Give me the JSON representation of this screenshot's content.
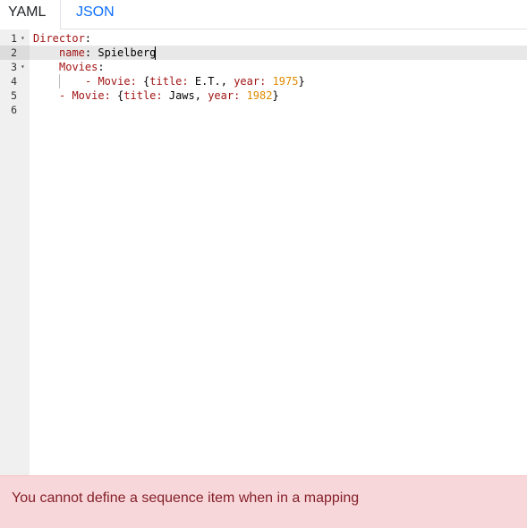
{
  "tabs": {
    "yaml": "YAML",
    "json": "JSON"
  },
  "editor": {
    "line_numbers": [
      "1",
      "2",
      "3",
      "4",
      "5",
      "6"
    ],
    "fold_marker": "▾",
    "lines": [
      {
        "key": "Director",
        "colon": ":"
      },
      {
        "key": "name",
        "colon": ":",
        "value": " Spielberg"
      },
      {
        "key": "Movies",
        "colon": ":"
      },
      {
        "dash": "- ",
        "key": "Movie",
        "colon": ":",
        "open": " {",
        "k1": "title",
        "c1": ":",
        "v1": " E.T.",
        "sep": ", ",
        "k2": "year",
        "c2": ":",
        "sp": " ",
        "v2": "1975",
        "close": "}"
      },
      {
        "dash": "- ",
        "key": "Movie",
        "colon": ":",
        "open": " {",
        "k1": "title",
        "c1": ":",
        "v1": " Jaws",
        "sep": ", ",
        "k2": "year",
        "c2": ":",
        "sp": " ",
        "v2": "1982",
        "close": "}"
      },
      {}
    ]
  },
  "error": {
    "message": "You cannot define a sequence item when in a mapping"
  },
  "colors": {
    "key": "#a31515",
    "number": "#df8b00",
    "tab_active": "#0d6efd",
    "error_bg": "#f8d7da",
    "error_text": "#842029"
  }
}
